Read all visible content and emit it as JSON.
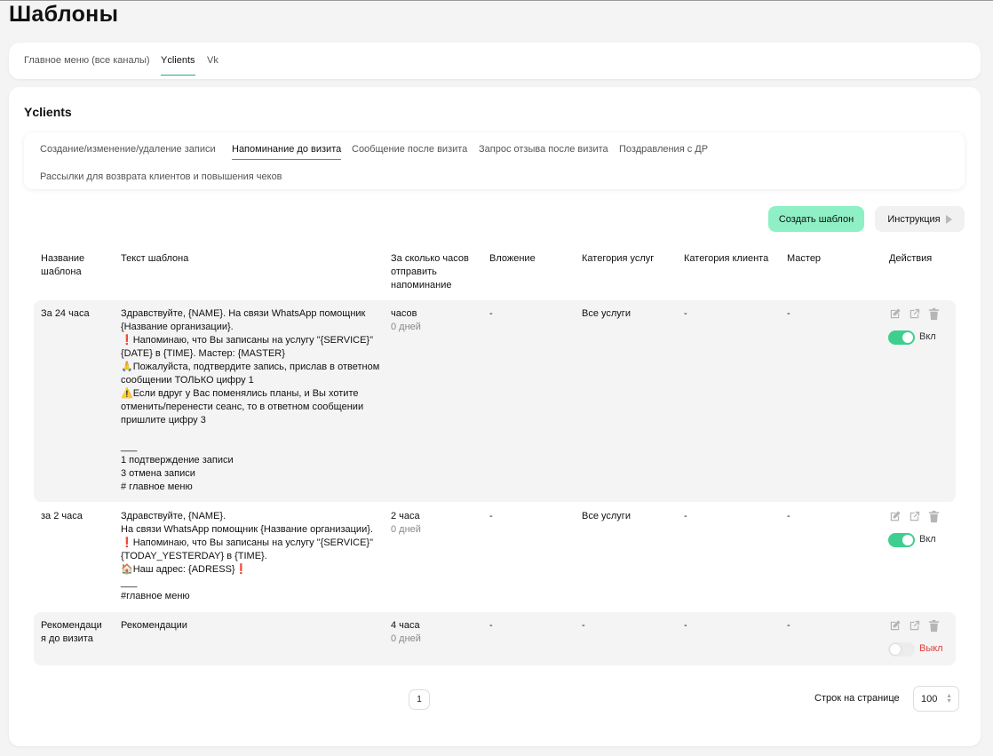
{
  "page": {
    "title": "Шаблоны"
  },
  "top_tabs": [
    {
      "label": "Главное меню (все каналы)",
      "active": false
    },
    {
      "label": "Yclients",
      "active": true
    },
    {
      "label": "Vk",
      "active": false
    }
  ],
  "section": {
    "title": "Yclients"
  },
  "sub_tabs": [
    {
      "label": "Создание/изменение/удаление записи",
      "active": false
    },
    {
      "label": "Напоминание до визита",
      "active": true
    },
    {
      "label": "Сообщение после визита",
      "active": false
    },
    {
      "label": "Запрос отзыва после визита",
      "active": false
    },
    {
      "label": "Поздравления с ДР",
      "active": false
    },
    {
      "label": "Рассылки для возврата клиентов и повышения чеков",
      "active": false
    }
  ],
  "actions": {
    "create_label": "Создать шаблон",
    "instruction_label": "Инструкция"
  },
  "table": {
    "headers": {
      "name": "Название\nшаблона",
      "text": "Текст шаблона",
      "hours": "За сколько часов\nотправить\nнапоминание",
      "attachment": "Вложение",
      "service_category": "Категория услуг",
      "client_category": "Категория клиента",
      "master": "Мастер",
      "actions": "Действия"
    },
    "rows": [
      {
        "name": "За 24 часа",
        "text": "Здравствуйте, {NAME}. На связи WhatsApp помощник\n{Название организации}.\n❗Напоминаю, что Вы записаны на услугу \"{SERVICE}\"\n{DATE} в {TIME}. Мастер: {MASTER}\n🙏Пожалуйста, подтвердите запись, прислав в ответном\nсообщении ТОЛЬКО цифру 1\n⚠️Если вдруг у Вас поменялись планы, и Вы хотите\nотменить/перенести сеанс, то в ответном сообщении\nпришлите цифру 3\n\n___\n1 подтверждение записи\n3 отмена записи\n# главное меню",
        "hours": "часов",
        "days": "0 дней",
        "attachment": "-",
        "service_category": "Все услуги",
        "client_category": "-",
        "master": "-",
        "toggle_label": "Вкл",
        "enabled": true
      },
      {
        "name": "за 2 часа",
        "text": "Здравствуйте, {NAME}.\nНа связи WhatsApp помощник {Название организации}.\n❗Напоминаю, что Вы записаны на услугу \"{SERVICE}\"\n{TODAY_YESTERDAY} в {TIME}.\n🏠Наш адрес: {ADRESS}❗\n___\n#главное меню",
        "hours": "2 часа",
        "days": "0 дней",
        "attachment": "-",
        "service_category": "Все услуги",
        "client_category": "-",
        "master": "-",
        "toggle_label": "Вкл",
        "enabled": true
      },
      {
        "name": "Рекомендаци\nя до визита",
        "text": "Рекомендации",
        "hours": "4 часа",
        "days": "0 дней",
        "attachment": "-",
        "service_category": "-",
        "client_category": "-",
        "master": "-",
        "toggle_label": "Выкл",
        "enabled": false
      }
    ]
  },
  "pagination": {
    "page": "1",
    "rows_label": "Строк на странице",
    "rows_value": "100"
  },
  "icons": {
    "edit": "edit-icon",
    "open": "external-link-icon",
    "delete": "trash-icon"
  },
  "colors": {
    "accent": "#22a98a",
    "create_button": "#8ef0c4",
    "toggle_on": "#3ecf8e",
    "off_label": "#e03b3b"
  }
}
